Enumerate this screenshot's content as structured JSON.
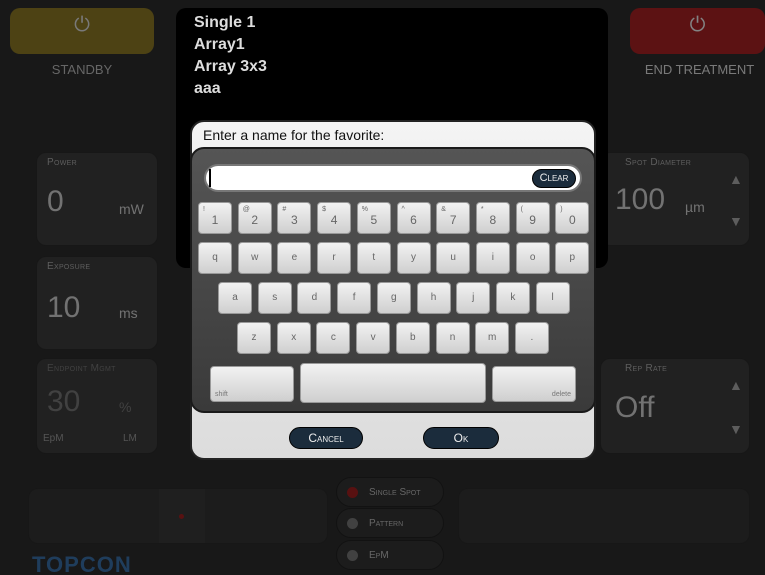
{
  "top": {
    "standby_label": "STANDBY",
    "end_treatment_label": "END TREATMENT"
  },
  "params": {
    "power": {
      "label": "Power",
      "value": "0",
      "unit": "mW"
    },
    "exposure": {
      "label": "Exposure",
      "value": "10",
      "unit": "ms"
    },
    "endpoint": {
      "label": "Endpoint Mgmt",
      "value": "30",
      "unit": "%",
      "epm": "EpM",
      "lm": "LM"
    },
    "spot_diameter": {
      "label": "Spot Diameter",
      "value": "100",
      "unit": "µm"
    },
    "rep_rate": {
      "label": "Rep Rate",
      "value": "Off"
    }
  },
  "modes": {
    "single_spot": "Single Spot",
    "pattern": "Pattern",
    "epm": "EpM"
  },
  "favorites": [
    "Single 1",
    "Array1",
    "Array 3x3",
    "aaa"
  ],
  "dialog": {
    "prompt": "Enter a name for the favorite:",
    "input_value": "",
    "clear_label": "Clear",
    "cancel_label": "Cancel",
    "ok_label": "Ok"
  },
  "keyboard": {
    "number_row": [
      {
        "main": "1",
        "shift": "!"
      },
      {
        "main": "2",
        "shift": "@"
      },
      {
        "main": "3",
        "shift": "#"
      },
      {
        "main": "4",
        "shift": "$"
      },
      {
        "main": "5",
        "shift": "%"
      },
      {
        "main": "6",
        "shift": "^"
      },
      {
        "main": "7",
        "shift": "&"
      },
      {
        "main": "8",
        "shift": "*"
      },
      {
        "main": "9",
        "shift": "("
      },
      {
        "main": "0",
        "shift": ")"
      }
    ],
    "row1": [
      "q",
      "w",
      "e",
      "r",
      "t",
      "y",
      "u",
      "i",
      "o",
      "p"
    ],
    "row2": [
      "a",
      "s",
      "d",
      "f",
      "g",
      "h",
      "j",
      "k",
      "l"
    ],
    "row3": [
      "z",
      "x",
      "c",
      "v",
      "b",
      "n",
      "m",
      "."
    ],
    "shift_label": "shift",
    "delete_label": "delete"
  },
  "brand": "TOPCON",
  "colors": {
    "standby": "#b89a2a",
    "end_treatment": "#c0282a",
    "dialog_button": "#1b2c3c",
    "single_spot_led": "#c02020"
  }
}
